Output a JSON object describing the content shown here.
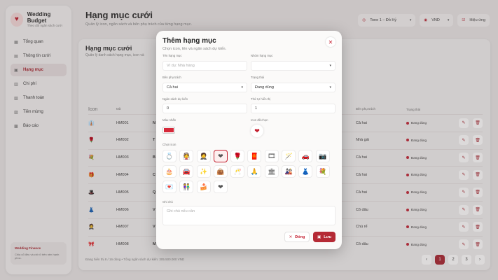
{
  "sidebar": {
    "brand_title": "Wedding Budget",
    "brand_sub": "Theo dõi ngân sách cưới",
    "items": [
      {
        "label": "Tổng quan",
        "icon": "▦"
      },
      {
        "label": "Thông tin cưới",
        "icon": "▤"
      },
      {
        "label": "Hạng mục",
        "icon": "▣"
      },
      {
        "label": "Chi phí",
        "icon": "▥"
      },
      {
        "label": "Thanh toán",
        "icon": "▧"
      },
      {
        "label": "Tiền mừng",
        "icon": "▨"
      },
      {
        "label": "Báo cáo",
        "icon": "▩"
      }
    ],
    "footer_title": "Wedding Finance",
    "footer_text": "Chia cổ đều và chi rõ trên nền hạnh phúc."
  },
  "header": {
    "title": "Hạng mục cưới",
    "subtitle": "Quản lý icon, ngân sách và bên phụ trách của từng hạng mục.",
    "tone": "Tone 1 – Đỏ Hỷ",
    "currency": "VND",
    "effect_label": "Hiệu ứng"
  },
  "card": {
    "title": "Hạng mục cưới",
    "subtitle": "Quản lý danh sách hạng mục, icon và"
  },
  "table": {
    "headers": [
      "Icon",
      "Mã",
      "",
      "Bên phụ trách",
      "Trạng thái"
    ],
    "rows": [
      {
        "icon": "👔",
        "code": "HM001",
        "name": "N",
        "owner": "Cả hai",
        "status": "Đang dùng"
      },
      {
        "icon": "🌹",
        "code": "HM002",
        "name": "T",
        "owner": "Nhà gái",
        "status": "Đang dùng"
      },
      {
        "icon": "💐",
        "code": "HM003",
        "name": "B",
        "owner": "Cả hai",
        "status": "Đang dùng"
      },
      {
        "icon": "🎁",
        "code": "HM004",
        "name": "C",
        "owner": "Cả hai",
        "status": "Đang dùng"
      },
      {
        "icon": "🎩",
        "code": "HM005",
        "name": "Q",
        "owner": "Cả hai",
        "status": "Đang dùng"
      },
      {
        "icon": "👗",
        "code": "HM006",
        "name": "V",
        "owner": "Cô dâu",
        "status": "Đang dùng"
      },
      {
        "icon": "🤵",
        "code": "HM007",
        "name": "V",
        "owner": "Chú rể",
        "status": "Đang dùng"
      },
      {
        "icon": "🎀",
        "code": "HM008",
        "name": "M",
        "owner": "Cô dâu",
        "status": "Đang dùng"
      }
    ],
    "footer": "Đang hiển thị 8 / 16 dòng • Tổng ngân sách dự kiến: 305.500.000 VND",
    "pages": [
      "‹",
      "1",
      "2",
      "3",
      "›"
    ]
  },
  "modal": {
    "title": "Thêm hạng mục",
    "subtitle": "Chọn icon, tên và ngân sách dự kiến.",
    "name_label": "Tên hạng mục",
    "name_placeholder": "Ví dụ: Nhà hàng",
    "group_label": "Nhóm hạng mục",
    "group_value": "",
    "owner_label": "Bên phụ trách",
    "owner_value": "Cả hai",
    "status_label": "Trạng thái",
    "status_value": "Đang dùng",
    "budget_label": "Ngân sách dự kiến",
    "budget_value": "0",
    "order_label": "Thứ tự hiển thị",
    "order_value": "1",
    "color_label": "Màu nhấn",
    "color_value": "#d62839",
    "picked_label": "Icon đã chọn",
    "picked_icon": "❤",
    "picker_label": "Chọn icon",
    "icons": [
      "💍",
      "👰",
      "🤵",
      "❤",
      "🌹",
      "🧧",
      "🎞",
      "🪄",
      "🚗",
      "📷",
      "🎂",
      "🚘",
      "✨",
      "👜",
      "🥂",
      "🙏",
      "🏛",
      "🎎",
      "👗",
      "💐",
      "💌",
      "👫",
      "🍰",
      "❤"
    ],
    "selected_icon_index": 3,
    "note_label": "Ghi chú",
    "note_placeholder": "Ghi chú nếu cần",
    "cancel_label": "Đóng",
    "save_label": "Lưu"
  }
}
